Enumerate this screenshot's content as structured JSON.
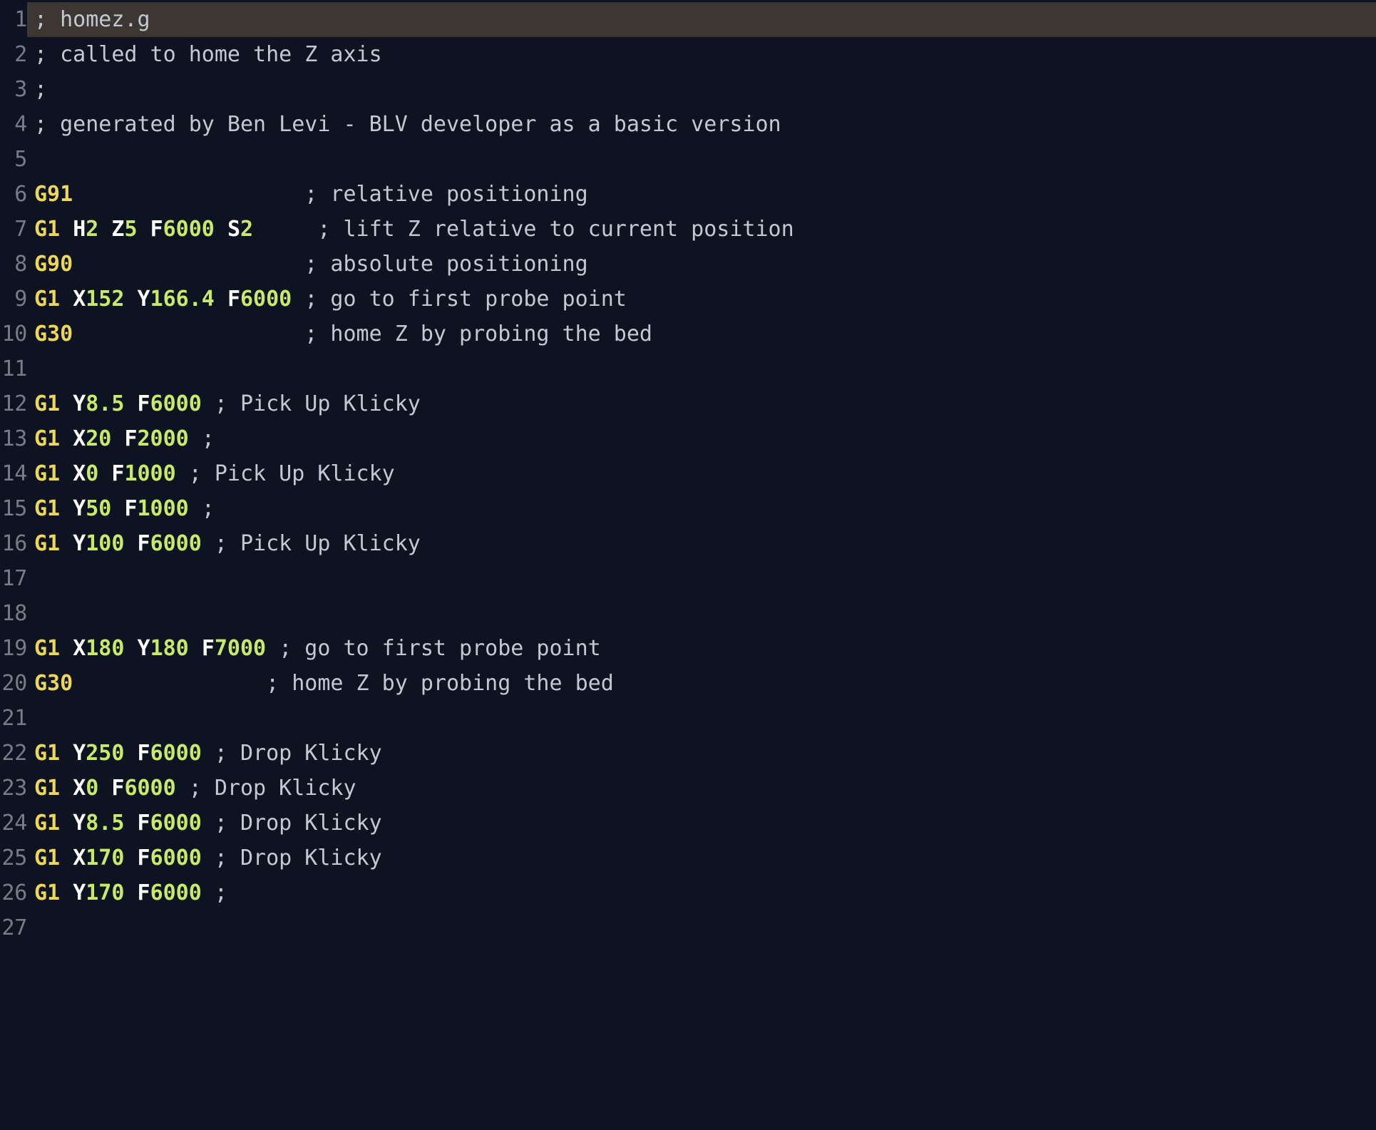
{
  "app": {
    "type": "code-editor",
    "file_name": "homez.g",
    "language": "gcode",
    "theme": "dark",
    "background_color": "#0d1321",
    "gutter_color": "#767d89",
    "highlight_color": "#3d3733",
    "syntax_colors": {
      "command": "#ecd75a",
      "axis_letter": "#ffffff",
      "number": "#c9e96b",
      "comment": "#c3c8d1"
    },
    "highlighted_line": 1,
    "first_visible_line": 1,
    "last_visible_line": 27
  },
  "lines": [
    {
      "number": "1",
      "highlighted": true,
      "tokens": [
        {
          "t": "cmt",
          "v": "; homez.g"
        }
      ]
    },
    {
      "number": "2",
      "highlighted": false,
      "tokens": [
        {
          "t": "cmt",
          "v": "; called to home the Z axis"
        }
      ]
    },
    {
      "number": "3",
      "highlighted": false,
      "tokens": [
        {
          "t": "cmt",
          "v": ";"
        }
      ]
    },
    {
      "number": "4",
      "highlighted": false,
      "tokens": [
        {
          "t": "cmt",
          "v": "; generated by Ben Levi - BLV developer as a basic version"
        }
      ]
    },
    {
      "number": "5",
      "highlighted": false,
      "tokens": []
    },
    {
      "number": "6",
      "highlighted": false,
      "tokens": [
        {
          "t": "cmd",
          "v": "G91"
        },
        {
          "t": "plain",
          "v": "                  "
        },
        {
          "t": "cmt",
          "v": "; relative positioning"
        }
      ]
    },
    {
      "number": "7",
      "highlighted": false,
      "tokens": [
        {
          "t": "cmd",
          "v": "G1"
        },
        {
          "t": "plain",
          "v": " "
        },
        {
          "t": "axis",
          "v": "H"
        },
        {
          "t": "num",
          "v": "2"
        },
        {
          "t": "plain",
          "v": " "
        },
        {
          "t": "axis",
          "v": "Z"
        },
        {
          "t": "num",
          "v": "5"
        },
        {
          "t": "plain",
          "v": " "
        },
        {
          "t": "axis",
          "v": "F"
        },
        {
          "t": "num",
          "v": "6000"
        },
        {
          "t": "plain",
          "v": " "
        },
        {
          "t": "axis",
          "v": "S"
        },
        {
          "t": "num",
          "v": "2"
        },
        {
          "t": "plain",
          "v": "     "
        },
        {
          "t": "cmt",
          "v": "; lift Z relative to current position"
        }
      ]
    },
    {
      "number": "8",
      "highlighted": false,
      "tokens": [
        {
          "t": "cmd",
          "v": "G90"
        },
        {
          "t": "plain",
          "v": "                  "
        },
        {
          "t": "cmt",
          "v": "; absolute positioning"
        }
      ]
    },
    {
      "number": "9",
      "highlighted": false,
      "tokens": [
        {
          "t": "cmd",
          "v": "G1"
        },
        {
          "t": "plain",
          "v": " "
        },
        {
          "t": "axis",
          "v": "X"
        },
        {
          "t": "num",
          "v": "152"
        },
        {
          "t": "plain",
          "v": " "
        },
        {
          "t": "axis",
          "v": "Y"
        },
        {
          "t": "num",
          "v": "166.4"
        },
        {
          "t": "plain",
          "v": " "
        },
        {
          "t": "axis",
          "v": "F"
        },
        {
          "t": "num",
          "v": "6000"
        },
        {
          "t": "plain",
          "v": " "
        },
        {
          "t": "cmt",
          "v": "; go to first probe point"
        }
      ]
    },
    {
      "number": "10",
      "highlighted": false,
      "tokens": [
        {
          "t": "cmd",
          "v": "G30"
        },
        {
          "t": "plain",
          "v": "                  "
        },
        {
          "t": "cmt",
          "v": "; home Z by probing the bed"
        }
      ]
    },
    {
      "number": "11",
      "highlighted": false,
      "tokens": []
    },
    {
      "number": "12",
      "highlighted": false,
      "tokens": [
        {
          "t": "cmd",
          "v": "G1"
        },
        {
          "t": "plain",
          "v": " "
        },
        {
          "t": "axis",
          "v": "Y"
        },
        {
          "t": "num",
          "v": "8.5"
        },
        {
          "t": "plain",
          "v": " "
        },
        {
          "t": "axis",
          "v": "F"
        },
        {
          "t": "num",
          "v": "6000"
        },
        {
          "t": "plain",
          "v": " "
        },
        {
          "t": "cmt",
          "v": "; Pick Up Klicky"
        }
      ]
    },
    {
      "number": "13",
      "highlighted": false,
      "tokens": [
        {
          "t": "cmd",
          "v": "G1"
        },
        {
          "t": "plain",
          "v": " "
        },
        {
          "t": "axis",
          "v": "X"
        },
        {
          "t": "num",
          "v": "20"
        },
        {
          "t": "plain",
          "v": " "
        },
        {
          "t": "axis",
          "v": "F"
        },
        {
          "t": "num",
          "v": "2000"
        },
        {
          "t": "plain",
          "v": " "
        },
        {
          "t": "cmt",
          "v": ";"
        }
      ]
    },
    {
      "number": "14",
      "highlighted": false,
      "tokens": [
        {
          "t": "cmd",
          "v": "G1"
        },
        {
          "t": "plain",
          "v": " "
        },
        {
          "t": "axis",
          "v": "X"
        },
        {
          "t": "num",
          "v": "0"
        },
        {
          "t": "plain",
          "v": " "
        },
        {
          "t": "axis",
          "v": "F"
        },
        {
          "t": "num",
          "v": "1000"
        },
        {
          "t": "plain",
          "v": " "
        },
        {
          "t": "cmt",
          "v": "; Pick Up Klicky"
        }
      ]
    },
    {
      "number": "15",
      "highlighted": false,
      "tokens": [
        {
          "t": "cmd",
          "v": "G1"
        },
        {
          "t": "plain",
          "v": " "
        },
        {
          "t": "axis",
          "v": "Y"
        },
        {
          "t": "num",
          "v": "50"
        },
        {
          "t": "plain",
          "v": " "
        },
        {
          "t": "axis",
          "v": "F"
        },
        {
          "t": "num",
          "v": "1000"
        },
        {
          "t": "plain",
          "v": " "
        },
        {
          "t": "cmt",
          "v": ";"
        }
      ]
    },
    {
      "number": "16",
      "highlighted": false,
      "tokens": [
        {
          "t": "cmd",
          "v": "G1"
        },
        {
          "t": "plain",
          "v": " "
        },
        {
          "t": "axis",
          "v": "Y"
        },
        {
          "t": "num",
          "v": "100"
        },
        {
          "t": "plain",
          "v": " "
        },
        {
          "t": "axis",
          "v": "F"
        },
        {
          "t": "num",
          "v": "6000"
        },
        {
          "t": "plain",
          "v": " "
        },
        {
          "t": "cmt",
          "v": "; Pick Up Klicky"
        }
      ]
    },
    {
      "number": "17",
      "highlighted": false,
      "tokens": []
    },
    {
      "number": "18",
      "highlighted": false,
      "tokens": []
    },
    {
      "number": "19",
      "highlighted": false,
      "tokens": [
        {
          "t": "cmd",
          "v": "G1"
        },
        {
          "t": "plain",
          "v": " "
        },
        {
          "t": "axis",
          "v": "X"
        },
        {
          "t": "num",
          "v": "180"
        },
        {
          "t": "plain",
          "v": " "
        },
        {
          "t": "axis",
          "v": "Y"
        },
        {
          "t": "num",
          "v": "180"
        },
        {
          "t": "plain",
          "v": " "
        },
        {
          "t": "axis",
          "v": "F"
        },
        {
          "t": "num",
          "v": "7000"
        },
        {
          "t": "plain",
          "v": " "
        },
        {
          "t": "cmt",
          "v": "; go to first probe point"
        }
      ]
    },
    {
      "number": "20",
      "highlighted": false,
      "tokens": [
        {
          "t": "cmd",
          "v": "G30"
        },
        {
          "t": "plain",
          "v": "               "
        },
        {
          "t": "cmt",
          "v": "; home Z by probing the bed"
        }
      ]
    },
    {
      "number": "21",
      "highlighted": false,
      "tokens": []
    },
    {
      "number": "22",
      "highlighted": false,
      "tokens": [
        {
          "t": "cmd",
          "v": "G1"
        },
        {
          "t": "plain",
          "v": " "
        },
        {
          "t": "axis",
          "v": "Y"
        },
        {
          "t": "num",
          "v": "250"
        },
        {
          "t": "plain",
          "v": " "
        },
        {
          "t": "axis",
          "v": "F"
        },
        {
          "t": "num",
          "v": "6000"
        },
        {
          "t": "plain",
          "v": " "
        },
        {
          "t": "cmt",
          "v": "; Drop Klicky"
        }
      ]
    },
    {
      "number": "23",
      "highlighted": false,
      "tokens": [
        {
          "t": "cmd",
          "v": "G1"
        },
        {
          "t": "plain",
          "v": " "
        },
        {
          "t": "axis",
          "v": "X"
        },
        {
          "t": "num",
          "v": "0"
        },
        {
          "t": "plain",
          "v": " "
        },
        {
          "t": "axis",
          "v": "F"
        },
        {
          "t": "num",
          "v": "6000"
        },
        {
          "t": "plain",
          "v": " "
        },
        {
          "t": "cmt",
          "v": "; Drop Klicky"
        }
      ]
    },
    {
      "number": "24",
      "highlighted": false,
      "tokens": [
        {
          "t": "cmd",
          "v": "G1"
        },
        {
          "t": "plain",
          "v": " "
        },
        {
          "t": "axis",
          "v": "Y"
        },
        {
          "t": "num",
          "v": "8.5"
        },
        {
          "t": "plain",
          "v": " "
        },
        {
          "t": "axis",
          "v": "F"
        },
        {
          "t": "num",
          "v": "6000"
        },
        {
          "t": "plain",
          "v": " "
        },
        {
          "t": "cmt",
          "v": "; Drop Klicky"
        }
      ]
    },
    {
      "number": "25",
      "highlighted": false,
      "tokens": [
        {
          "t": "cmd",
          "v": "G1"
        },
        {
          "t": "plain",
          "v": " "
        },
        {
          "t": "axis",
          "v": "X"
        },
        {
          "t": "num",
          "v": "170"
        },
        {
          "t": "plain",
          "v": " "
        },
        {
          "t": "axis",
          "v": "F"
        },
        {
          "t": "num",
          "v": "6000"
        },
        {
          "t": "plain",
          "v": " "
        },
        {
          "t": "cmt",
          "v": "; Drop Klicky"
        }
      ]
    },
    {
      "number": "26",
      "highlighted": false,
      "tokens": [
        {
          "t": "cmd",
          "v": "G1"
        },
        {
          "t": "plain",
          "v": " "
        },
        {
          "t": "axis",
          "v": "Y"
        },
        {
          "t": "num",
          "v": "170"
        },
        {
          "t": "plain",
          "v": " "
        },
        {
          "t": "axis",
          "v": "F"
        },
        {
          "t": "num",
          "v": "6000"
        },
        {
          "t": "plain",
          "v": " "
        },
        {
          "t": "cmt",
          "v": ";"
        }
      ]
    },
    {
      "number": "27",
      "highlighted": false,
      "tokens": []
    }
  ]
}
